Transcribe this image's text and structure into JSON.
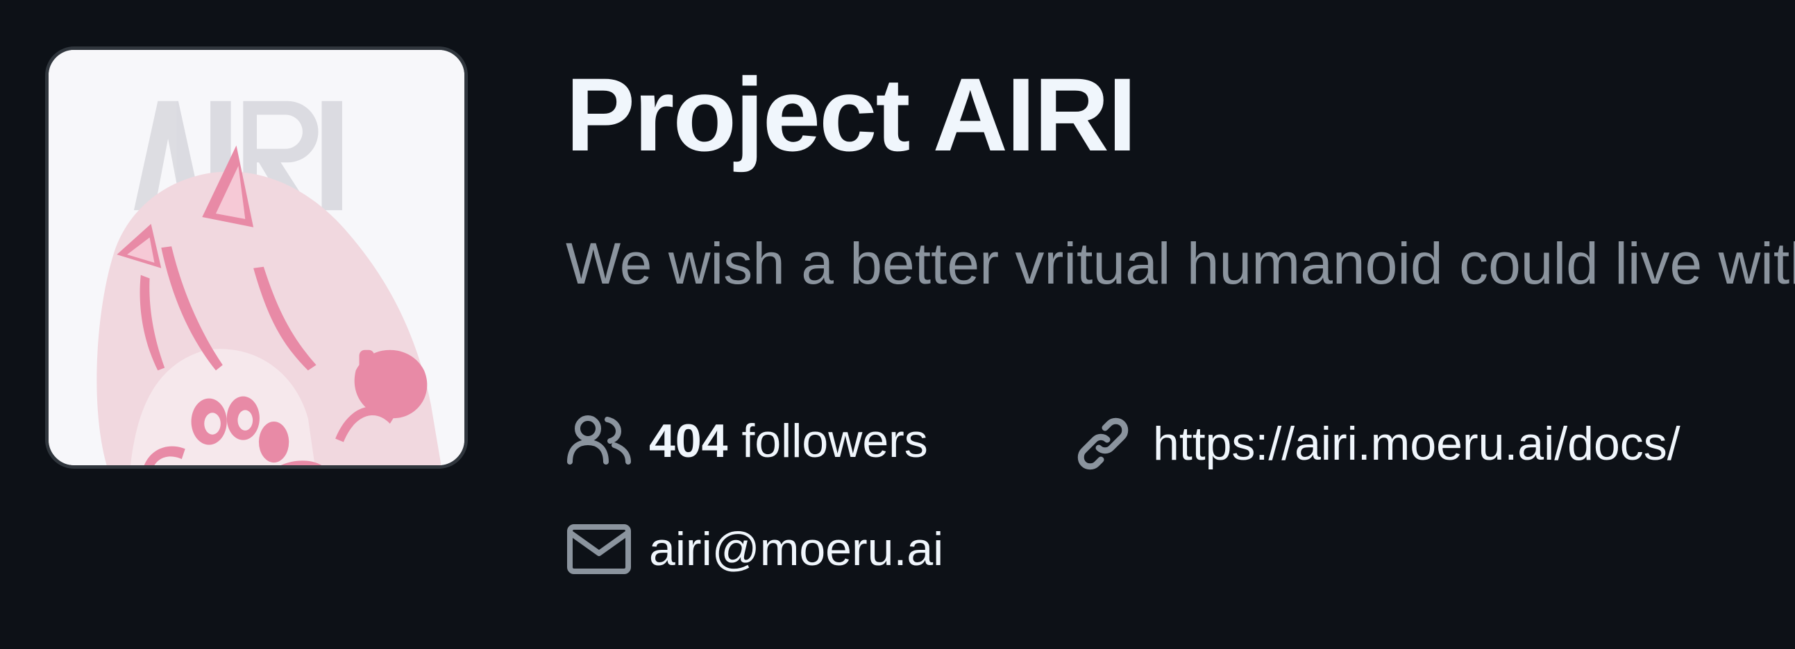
{
  "org": {
    "name": "Project AIRI",
    "description": "We wish a better vritual humanoid could live with us.",
    "avatar_alt": "AIRI",
    "followers_count": "404",
    "followers_label": "followers",
    "website": "https://airi.moeru.ai/docs/",
    "email": "airi@moeru.ai"
  },
  "icons": {
    "followers": "people-icon",
    "website": "link-icon",
    "email": "mail-icon"
  },
  "colors": {
    "background": "#0d1117",
    "title_text": "#f0f6fc",
    "muted_text": "#8b949e",
    "icon": "#8b949e",
    "avatar_background": "#f7f7fa",
    "avatar_border": "#30363d",
    "avatar_pink": "#e88aa6",
    "avatar_light_pink": "#f1d8df"
  }
}
